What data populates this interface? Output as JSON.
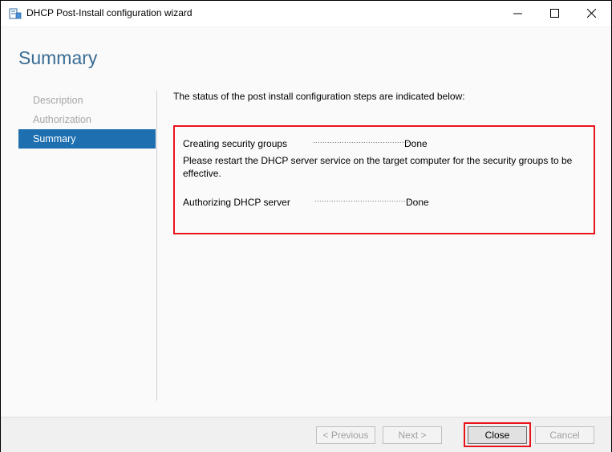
{
  "window": {
    "title": "DHCP Post-Install configuration wizard",
    "icon": "dhcp-server-icon",
    "controls": {
      "minimize": "–",
      "maximize": "☐",
      "close": "✕"
    }
  },
  "page": {
    "heading": "Summary",
    "intro": "The status of the post install configuration steps are indicated below:"
  },
  "nav": {
    "items": [
      {
        "label": "Description",
        "active": false
      },
      {
        "label": "Authorization",
        "active": false
      },
      {
        "label": "Summary",
        "active": true
      }
    ]
  },
  "status": {
    "steps": [
      {
        "label": "Creating security groups",
        "dots": "...........................................",
        "result": "Done"
      },
      {
        "label": "Authorizing DHCP server",
        "dots": "...........................................",
        "result": "Done"
      }
    ],
    "note": "Please restart the DHCP server service on the target computer for the security groups to be effective."
  },
  "buttons": {
    "previous": "< Previous",
    "next": "Next >",
    "close": "Close",
    "cancel": "Cancel"
  },
  "colors": {
    "heading": "#3a6d94",
    "nav_active": "#1e6fb0",
    "highlight": "#e8131a"
  }
}
